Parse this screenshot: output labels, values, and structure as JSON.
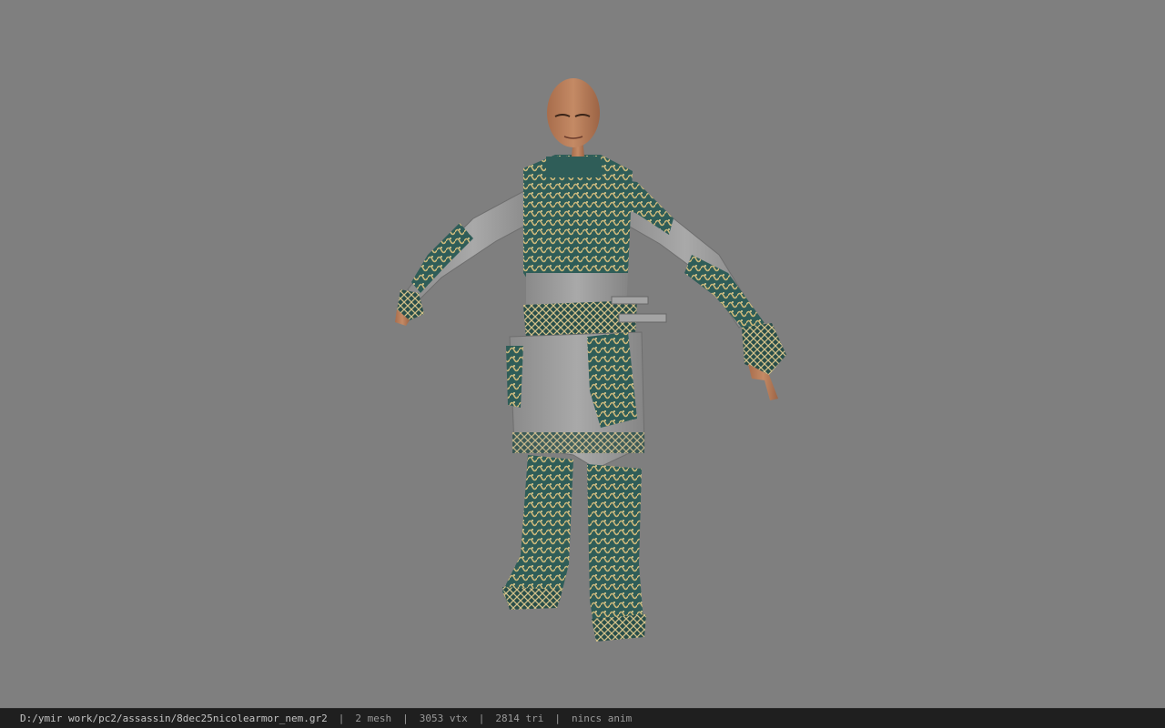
{
  "viewer": {
    "background_color": "#7f7f7f",
    "model": {
      "subject": "armored character model in T-pose",
      "colors": {
        "armor_teal": "#2f5d58",
        "armor_gold": "#cbb77a",
        "cloth_gray": "#9a9a9a",
        "skin": "#b77a55"
      }
    }
  },
  "status_bar": {
    "file_path": "D:/ymir work/pc2/assassin/8dec25nicolearmor_nem.gr2",
    "separator": "|",
    "mesh": "2 mesh",
    "vertices": "3053 vtx",
    "triangles": "2814 tri",
    "anim": "nincs anim"
  }
}
